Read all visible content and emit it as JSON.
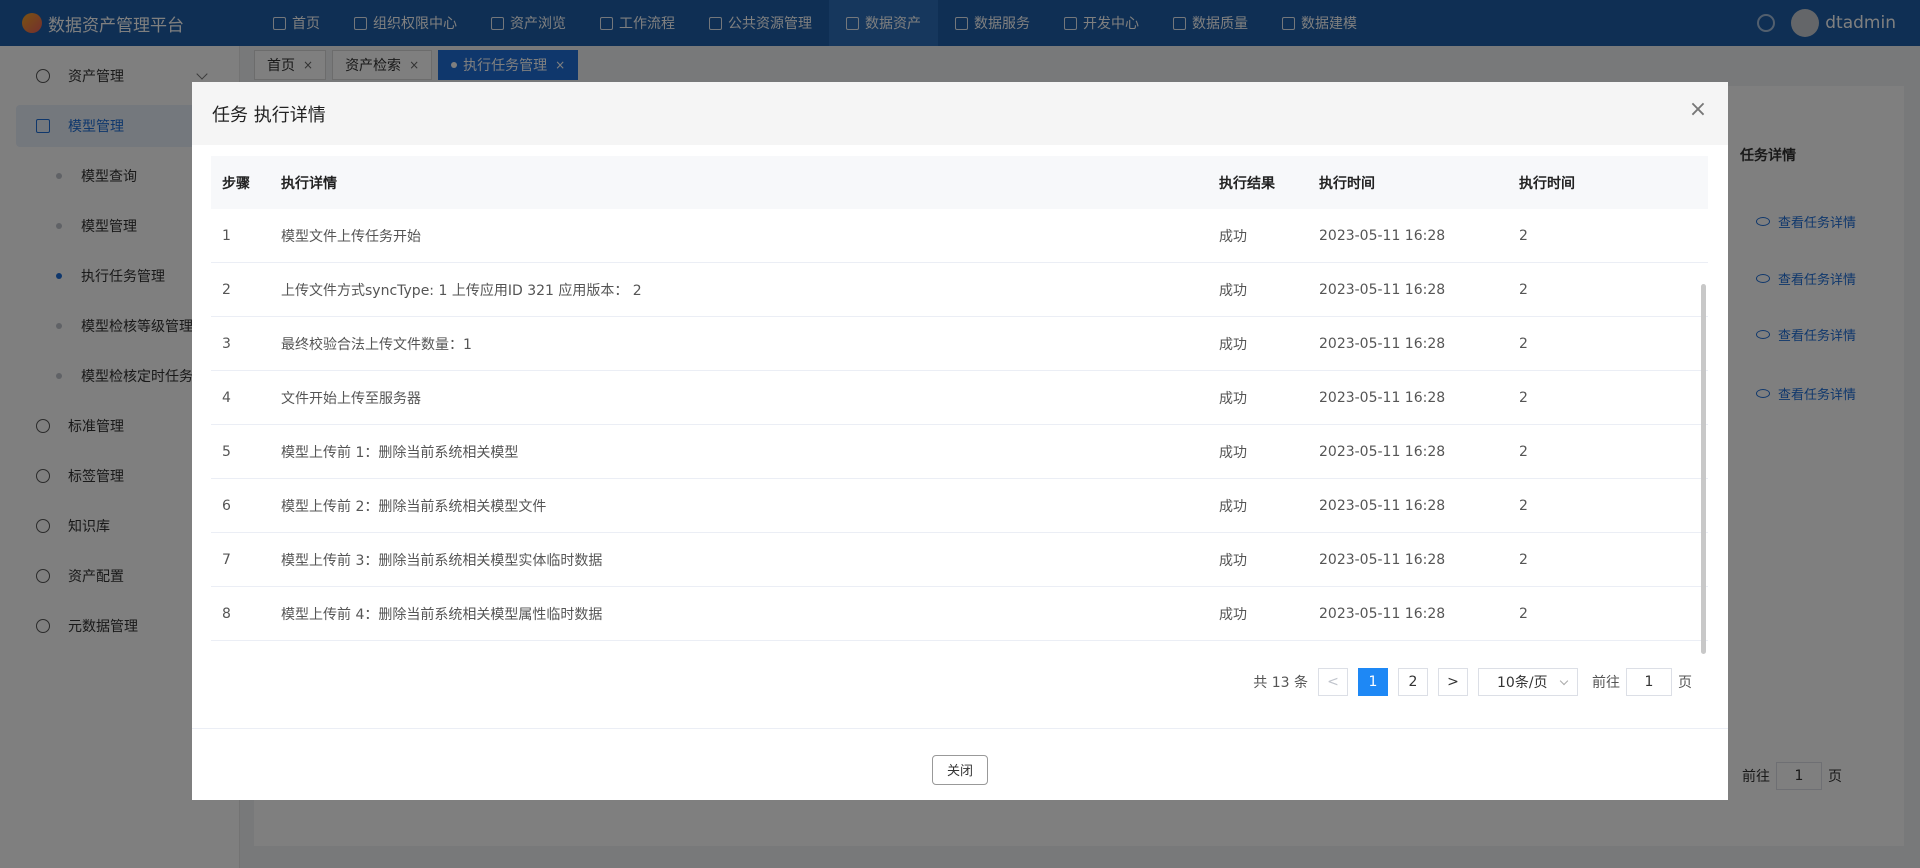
{
  "app": {
    "title": "数据资产管理平台",
    "user": "dtadmin"
  },
  "nav": [
    {
      "label": "首页"
    },
    {
      "label": "组织权限中心"
    },
    {
      "label": "资产浏览"
    },
    {
      "label": "工作流程"
    },
    {
      "label": "公共资源管理"
    },
    {
      "label": "数据资产"
    },
    {
      "label": "数据服务"
    },
    {
      "label": "开发中心"
    },
    {
      "label": "数据质量"
    },
    {
      "label": "数据建模"
    }
  ],
  "sidebar": {
    "items": [
      {
        "label": "资产管理"
      },
      {
        "label": "模型管理"
      },
      {
        "label": "标准管理"
      },
      {
        "label": "标签管理"
      },
      {
        "label": "知识库"
      },
      {
        "label": "资产配置"
      },
      {
        "label": "元数据管理"
      }
    ],
    "sub": [
      {
        "label": "模型查询"
      },
      {
        "label": "模型管理"
      },
      {
        "label": "执行任务管理"
      },
      {
        "label": "模型检核等级管理"
      },
      {
        "label": "模型检核定时任务"
      }
    ]
  },
  "tabs": [
    {
      "label": "首页"
    },
    {
      "label": "资产检索"
    },
    {
      "label": "执行任务管理"
    }
  ],
  "background": {
    "column_header": "任务详情",
    "link_label": "查看任务详情",
    "goto_label": "前往",
    "goto_value": "1",
    "page_suffix": "页"
  },
  "modal": {
    "title": "任务 执行详情",
    "columns": [
      "步骤",
      "执行详情",
      "执行结果",
      "执行时间",
      "执行时间"
    ],
    "rows": [
      {
        "step": "1",
        "detail": "模型文件上传任务开始",
        "result": "成功",
        "time": "2023-05-11 16:28",
        "duration": "2"
      },
      {
        "step": "2",
        "detail": "上传文件方式syncType: 1 上传应用ID 321 应用版本： 2",
        "result": "成功",
        "time": "2023-05-11 16:28",
        "duration": "2"
      },
      {
        "step": "3",
        "detail": "最终校验合法上传文件数量：1",
        "result": "成功",
        "time": "2023-05-11 16:28",
        "duration": "2"
      },
      {
        "step": "4",
        "detail": "文件开始上传至服务器",
        "result": "成功",
        "time": "2023-05-11 16:28",
        "duration": "2"
      },
      {
        "step": "5",
        "detail": "模型上传前 1：删除当前系统相关模型",
        "result": "成功",
        "time": "2023-05-11 16:28",
        "duration": "2"
      },
      {
        "step": "6",
        "detail": "模型上传前 2：删除当前系统相关模型文件",
        "result": "成功",
        "time": "2023-05-11 16:28",
        "duration": "2"
      },
      {
        "step": "7",
        "detail": "模型上传前 3：删除当前系统相关模型实体临时数据",
        "result": "成功",
        "time": "2023-05-11 16:28",
        "duration": "2"
      },
      {
        "step": "8",
        "detail": "模型上传前 4：删除当前系统相关模型属性临时数据",
        "result": "成功",
        "time": "2023-05-11 16:28",
        "duration": "2"
      }
    ],
    "pagination": {
      "total": "共 13 条",
      "prev": "<",
      "next": ">",
      "pages": [
        "1",
        "2"
      ],
      "page_size": "10条/页",
      "goto_label": "前往",
      "goto_value": "1",
      "page_suffix": "页"
    },
    "close_label": "关闭",
    "close_icon": "×"
  }
}
